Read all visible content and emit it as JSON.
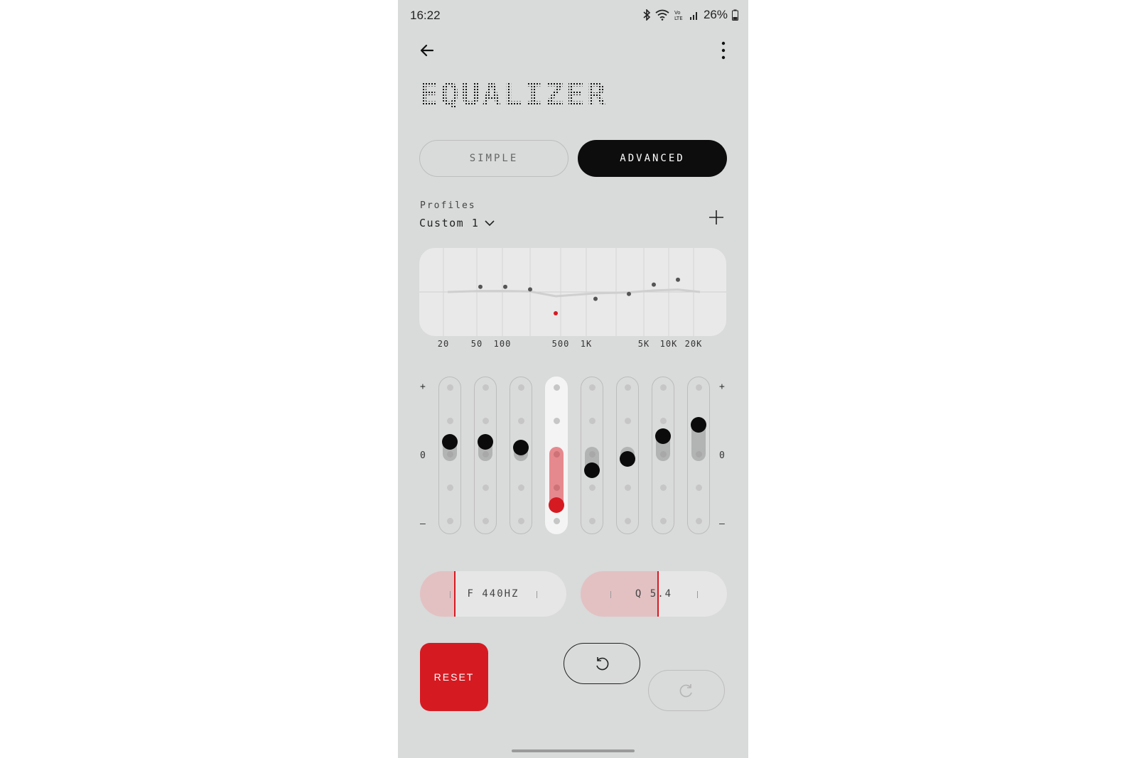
{
  "status": {
    "time": "16:22",
    "battery": "26%",
    "icons": [
      "bluetooth-icon",
      "wifi-icon",
      "volte-icon",
      "signal-icon",
      "battery-icon"
    ],
    "volte_label": "Vo) LTE"
  },
  "header": {
    "title": "EQUALIZER"
  },
  "mode": {
    "simple_label": "SIMPLE",
    "advanced_label": "ADVANCED",
    "selected": "ADVANCED"
  },
  "profiles": {
    "label": "Profiles",
    "selected": "Custom 1"
  },
  "graph": {
    "freq_labels": [
      "20",
      "50",
      "100",
      "500",
      "1K",
      "5K",
      "10K",
      "20K"
    ],
    "active_band": 3,
    "colors": {
      "active": "#d61a22",
      "point": "#555555"
    }
  },
  "sliders": {
    "plus_symbol": "+",
    "zero_symbol": "0",
    "minus_symbol": "–",
    "active_index": 3,
    "bands": [
      {
        "level": 0.18
      },
      {
        "level": 0.18
      },
      {
        "level": 0.09
      },
      {
        "level": -0.75
      },
      {
        "level": -0.24
      },
      {
        "level": -0.07
      },
      {
        "level": 0.26
      },
      {
        "level": 0.43
      }
    ]
  },
  "params": {
    "freq_label": "F 440HZ",
    "freq_fraction": 0.24,
    "q_label": "Q 5.4",
    "q_fraction": 0.53
  },
  "buttons": {
    "reset_label": "RESET"
  },
  "colors": {
    "accent": "#d61a22",
    "background": "#d9dada",
    "dark": "#0d0d0d"
  }
}
